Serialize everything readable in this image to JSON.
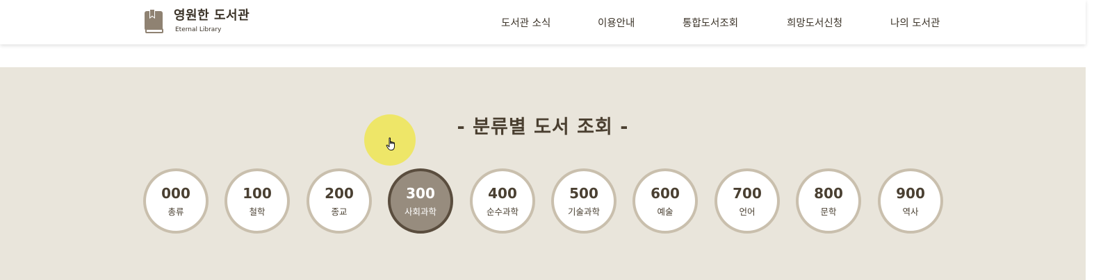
{
  "header": {
    "logo_title": "영원한 도서관",
    "logo_subtitle": "Eternal Library",
    "nav": [
      "도서관 소식",
      "이용안내",
      "통합도서조회",
      "희망도서신청",
      "나의 도서관"
    ]
  },
  "main": {
    "title": "- 분류별 도서 조회 -",
    "categories": [
      {
        "code": "000",
        "name": "총류"
      },
      {
        "code": "100",
        "name": "철학"
      },
      {
        "code": "200",
        "name": "종교"
      },
      {
        "code": "300",
        "name": "사회과학"
      },
      {
        "code": "400",
        "name": "순수과학"
      },
      {
        "code": "500",
        "name": "기술과학"
      },
      {
        "code": "600",
        "name": "예술"
      },
      {
        "code": "700",
        "name": "언어"
      },
      {
        "code": "800",
        "name": "문학"
      },
      {
        "code": "900",
        "name": "역사"
      }
    ],
    "active_category": "300"
  },
  "colors": {
    "background": "#e9e5db",
    "circle_border": "#c9bfad",
    "active_fill": "#978c7e",
    "active_border": "#5a4d3e",
    "text": "#3b3328",
    "cursor_highlight": "#f0e63c"
  },
  "icons": {
    "logo": "book-icon",
    "cursor": "hand-pointer-icon"
  }
}
